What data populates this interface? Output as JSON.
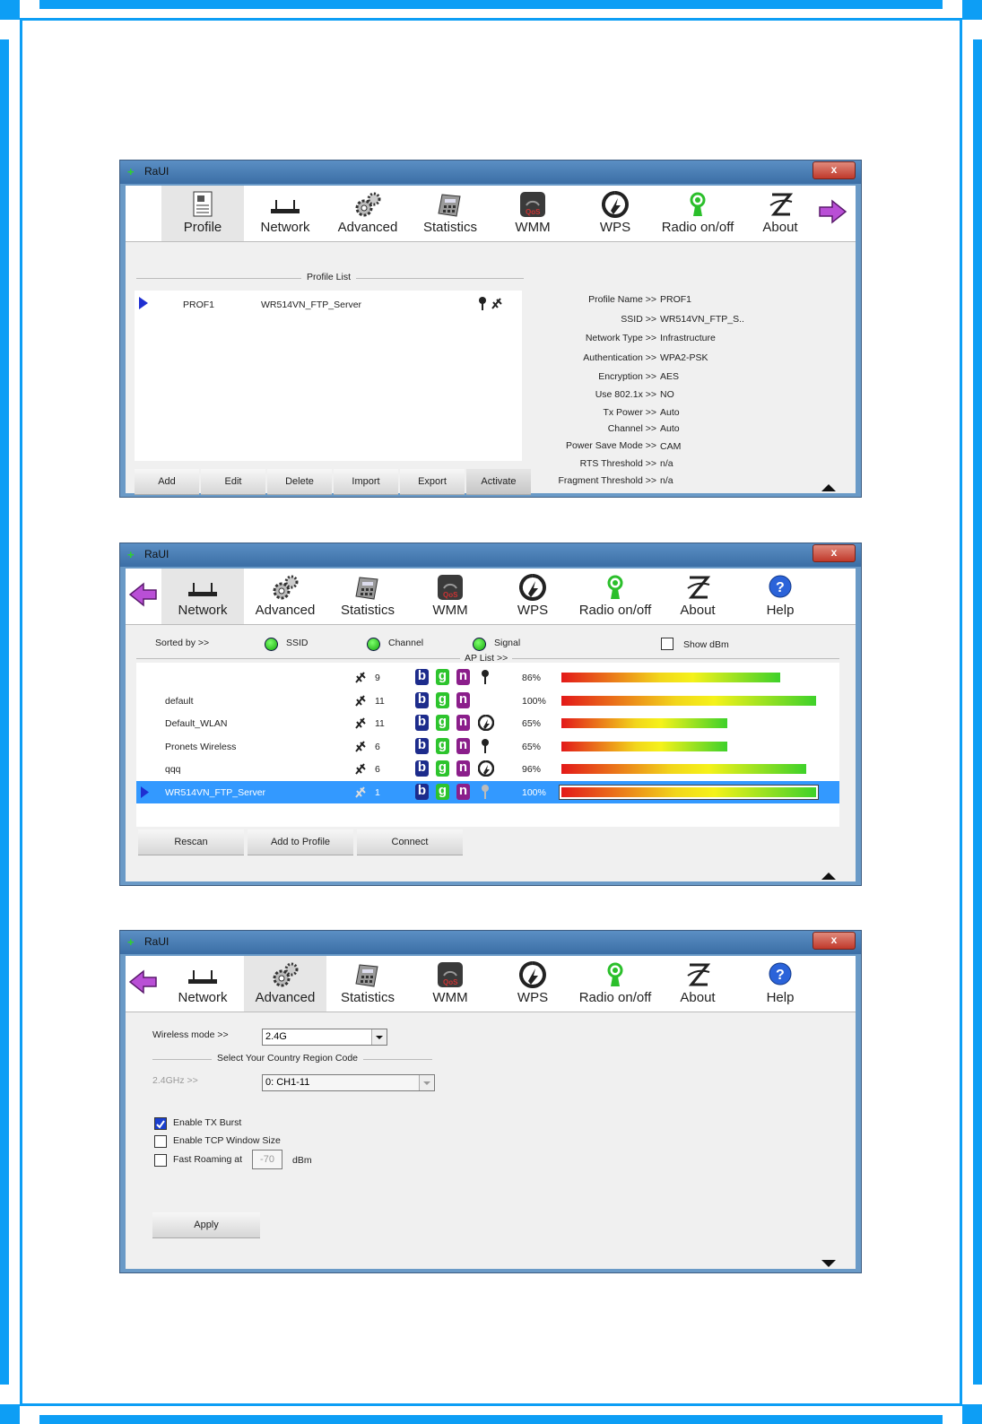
{
  "app_title": "RaUI",
  "close_label": "x",
  "window1": {
    "toolbar": [
      "Profile",
      "Network",
      "Advanced",
      "Statistics",
      "WMM",
      "WPS",
      "Radio on/off",
      "About"
    ],
    "profile_list_title": "Profile List",
    "profiles": [
      {
        "name": "PROF1",
        "ssid": "WR514VN_FTP_Server"
      }
    ],
    "buttons": [
      "Add",
      "Edit",
      "Delete",
      "Import",
      "Export",
      "Activate"
    ],
    "details": [
      {
        "label": "Profile Name >>",
        "value": "PROF1"
      },
      {
        "label": "SSID >>",
        "value": "WR514VN_FTP_S.."
      },
      {
        "label": "Network Type >>",
        "value": "Infrastructure"
      },
      {
        "label": "Authentication >>",
        "value": "WPA2-PSK"
      },
      {
        "label": "Encryption >>",
        "value": "AES"
      },
      {
        "label": "Use 802.1x >>",
        "value": "NO"
      },
      {
        "label": "Tx Power >>",
        "value": "Auto"
      },
      {
        "label": "Channel >>",
        "value": "Auto"
      },
      {
        "label": "Power Save Mode >>",
        "value": "CAM"
      },
      {
        "label": "RTS Threshold >>",
        "value": "n/a"
      },
      {
        "label": "Fragment Threshold >>",
        "value": "n/a"
      }
    ]
  },
  "window2": {
    "toolbar": [
      "Network",
      "Advanced",
      "Statistics",
      "WMM",
      "WPS",
      "Radio on/off",
      "About",
      "Help"
    ],
    "sorted_by": "Sorted by >>",
    "sort_ssid": "SSID",
    "sort_channel": "Channel",
    "sort_signal": "Signal",
    "show_dbm": "Show dBm",
    "ap_list_title": "AP List >>",
    "ap_rows": [
      {
        "ssid": "",
        "channel": "9",
        "signal": "86%",
        "level": 0.86,
        "lock": true,
        "wps": false
      },
      {
        "ssid": "default",
        "channel": "11",
        "signal": "100%",
        "level": 1.0,
        "lock": false,
        "wps": false
      },
      {
        "ssid": "Default_WLAN",
        "channel": "11",
        "signal": "65%",
        "level": 0.65,
        "lock": false,
        "wps": true
      },
      {
        "ssid": "Pronets Wireless",
        "channel": "6",
        "signal": "65%",
        "level": 0.65,
        "lock": true,
        "wps": false
      },
      {
        "ssid": "qqq",
        "channel": "6",
        "signal": "96%",
        "level": 0.96,
        "lock": false,
        "wps": true
      },
      {
        "ssid": "WR514VN_FTP_Server",
        "channel": "1",
        "signal": "100%",
        "level": 1.0,
        "lock": true,
        "wps": false,
        "selected": true
      }
    ],
    "buttons": [
      "Rescan",
      "Add to Profile",
      "Connect"
    ]
  },
  "window3": {
    "toolbar": [
      "Network",
      "Advanced",
      "Statistics",
      "WMM",
      "WPS",
      "Radio on/off",
      "About",
      "Help"
    ],
    "wireless_mode_label": "Wireless mode >>",
    "wireless_mode_value": "2.4G",
    "country_title": "Select Your Country Region Code",
    "band_label": "2.4GHz >>",
    "band_value": "0: CH1-11",
    "opt_tx_burst": "Enable TX Burst",
    "opt_tcp_window": "Enable TCP Window Size",
    "opt_fast_roaming": "Fast Roaming at",
    "roaming_value": "-70",
    "roaming_unit": "dBm",
    "apply": "Apply"
  },
  "colors": {
    "accent": "#0d9ef5",
    "selected_row": "#3399ff",
    "b_badge": "#1d2c8c",
    "g_badge": "#2dc42d",
    "n_badge": "#8b1e8b"
  }
}
